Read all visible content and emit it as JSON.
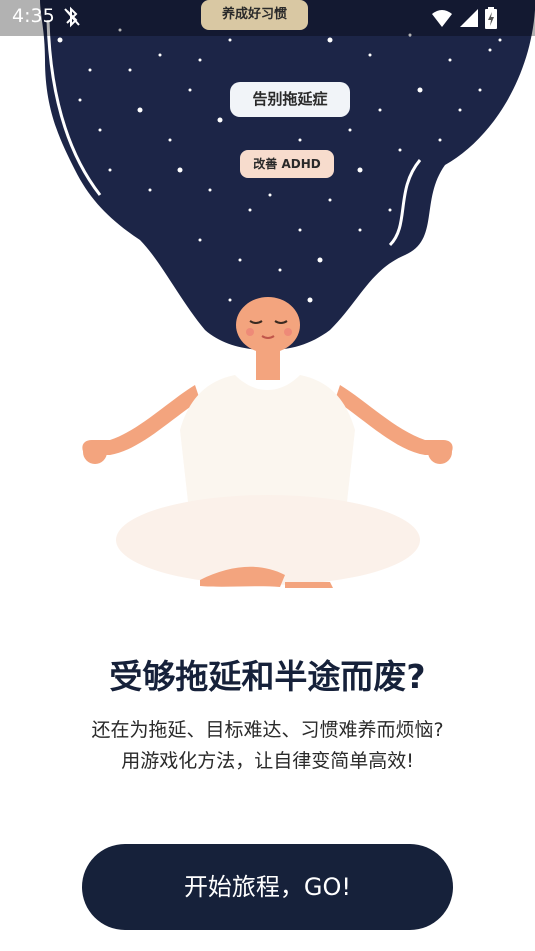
{
  "status_bar": {
    "time": "4:35",
    "left_icon": "bluetooth-off-icon",
    "right_icons": [
      "wifi-icon",
      "cellular-signal-icon",
      "battery-charging-icon"
    ]
  },
  "tags": {
    "top": "养成好习惯",
    "middle": "告别拖延症",
    "low": "改善 ADHD"
  },
  "headline": "受够拖延和半途而废?",
  "subtext": {
    "line1": "还在为拖延、目标难达、习惯难养而烦恼?",
    "line2": "用游戏化方法，让自律变简单高效!"
  },
  "cta": {
    "label": "开始旅程，GO!"
  },
  "colors": {
    "hair": "#1c2547",
    "brand_dark": "#16213a",
    "skin": "#f3a47e",
    "shirt": "#fbf6ef",
    "tag_gold": "#d9c8a3",
    "tag_peach": "#f7dccd"
  }
}
